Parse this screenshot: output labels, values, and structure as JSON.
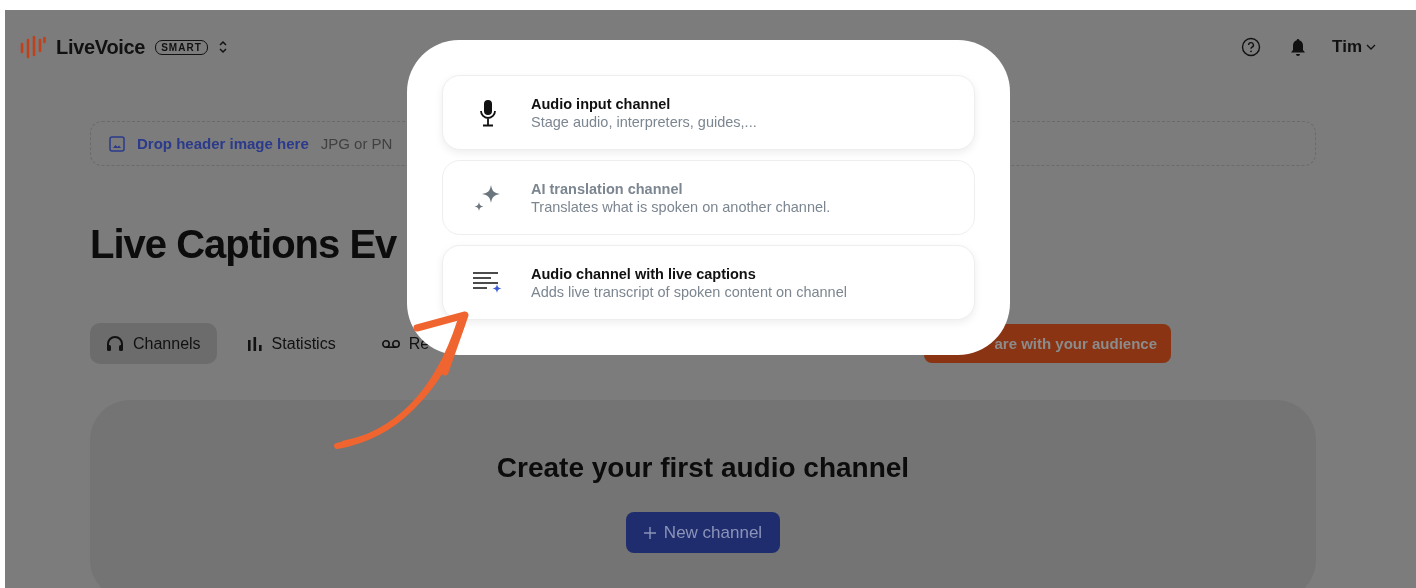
{
  "header": {
    "brand": "LiveVoice",
    "plan_badge": "SMART",
    "user": "Tim"
  },
  "dropzone": {
    "link": "Drop header image here",
    "hint": "JPG or PN"
  },
  "event_title": "Live Captions Ev",
  "tabs": [
    {
      "label": "Channels",
      "selected": true,
      "kind": "headphones"
    },
    {
      "label": "Statistics",
      "selected": false,
      "kind": "stats"
    },
    {
      "label": "Re",
      "selected": false,
      "kind": "recording"
    }
  ],
  "share_button": "are with your audience",
  "empty_state": {
    "heading": "Create your first audio channel",
    "button": "New channel"
  },
  "menu": {
    "options": [
      {
        "kind": "microphone",
        "title": "Audio input channel",
        "description": "Stage audio, interpreters, guides,...",
        "disabled": false
      },
      {
        "kind": "sparkle",
        "title": "AI translation channel",
        "description": "Translates what is spoken on another channel.",
        "disabled": true
      },
      {
        "kind": "captions",
        "title": "Audio channel with live captions",
        "description": "Adds live transcript of spoken content on channel",
        "disabled": false
      }
    ]
  }
}
